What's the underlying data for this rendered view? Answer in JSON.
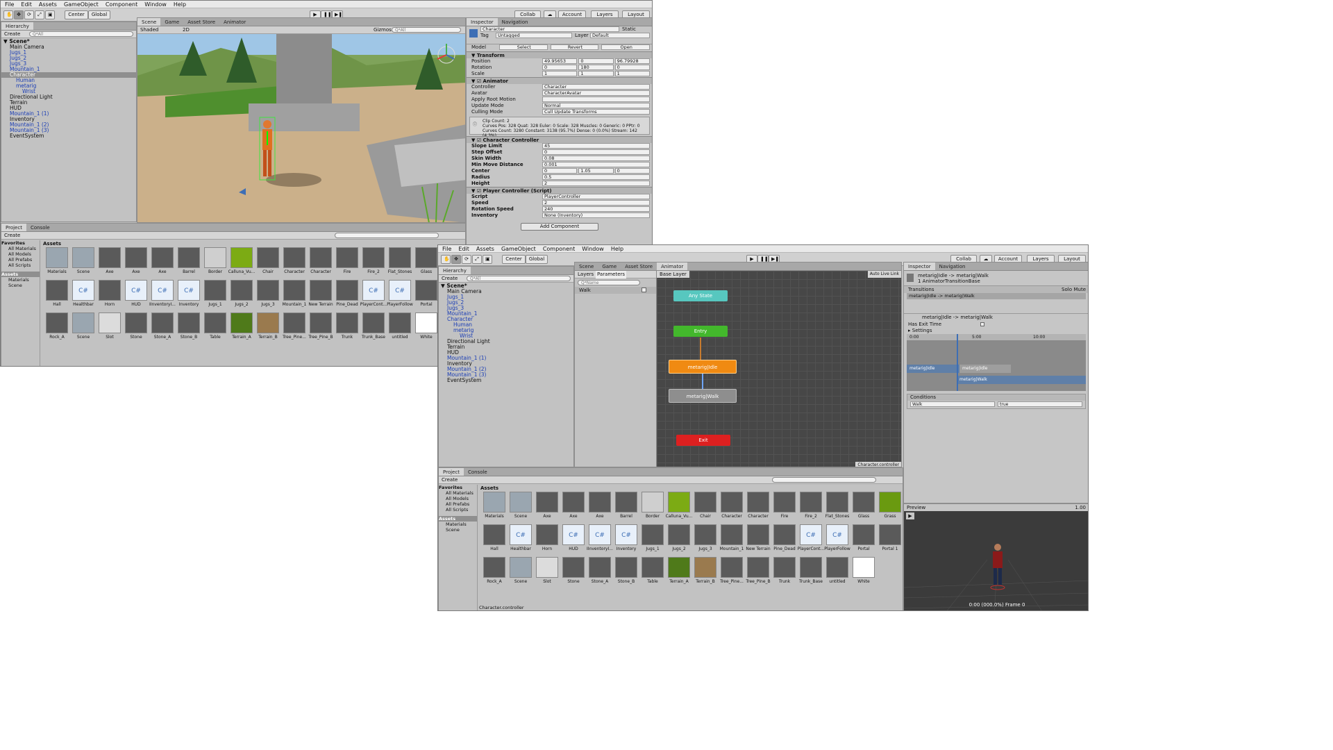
{
  "menu": [
    "File",
    "Edit",
    "Assets",
    "GameObject",
    "Component",
    "Window",
    "Help"
  ],
  "toolbar": {
    "center": "Center",
    "global": "Global",
    "collab": "Collab",
    "account": "Account",
    "layers": "Layers",
    "layout": "Layout"
  },
  "colors": {
    "panel": "#c2c2c2",
    "selection_blue": "#3d6eb5",
    "anystate": "#57c7bf",
    "entry": "#43b82c",
    "idle": "#f08a12",
    "exit": "#dd2020",
    "walk": "#8e8e8e"
  },
  "win1": {
    "hierarchy": {
      "title": "Hierarchy",
      "create": "Create",
      "search": "Q*All",
      "scene": "Scene*",
      "items": [
        {
          "label": "Main Camera",
          "style": "",
          "indent": 1
        },
        {
          "label": "Jugs_1",
          "style": "blue",
          "indent": 1
        },
        {
          "label": "Jugs_2",
          "style": "blue",
          "indent": 1
        },
        {
          "label": "Jugs_3",
          "style": "blue",
          "indent": 1
        },
        {
          "label": "Mountain_1",
          "style": "blue",
          "indent": 1
        },
        {
          "label": "Character",
          "style": "sel",
          "indent": 1
        },
        {
          "label": "Human",
          "style": "blue",
          "indent": 2
        },
        {
          "label": "metarig",
          "style": "blue",
          "indent": 2
        },
        {
          "label": "Wrist",
          "style": "blue",
          "indent": 3
        },
        {
          "label": "Directional Light",
          "style": "",
          "indent": 1
        },
        {
          "label": "Terrain",
          "style": "",
          "indent": 1
        },
        {
          "label": "HUD",
          "style": "",
          "indent": 1
        },
        {
          "label": "Mountain_1 (1)",
          "style": "blue",
          "indent": 1
        },
        {
          "label": "Inventory",
          "style": "",
          "indent": 1
        },
        {
          "label": "Mountain_1 (2)",
          "style": "blue",
          "indent": 1
        },
        {
          "label": "Mountain_1 (3)",
          "style": "blue",
          "indent": 1
        },
        {
          "label": "EventSystem",
          "style": "",
          "indent": 1
        }
      ]
    },
    "scene_tabs": [
      "Scene",
      "Game",
      "Asset Store",
      "Animator"
    ],
    "scene_bar": {
      "shaded": "Shaded",
      "mode2d": "2D",
      "gizmos": "Gizmos",
      "search": "Q*All"
    },
    "inspector": {
      "tabs": [
        "Inspector",
        "Navigation"
      ],
      "object_name": "Character",
      "static": "Static",
      "tag_label": "Tag",
      "tag": "Untagged",
      "layer_label": "Layer",
      "layer": "Default",
      "model_label": "Model",
      "select": "Select",
      "revert": "Revert",
      "open": "Open",
      "transform": {
        "title": "Transform",
        "position_label": "Position",
        "rotation_label": "Rotation",
        "scale_label": "Scale",
        "position": [
          "49.95653",
          "0",
          "96.79928"
        ],
        "rotation": [
          "0",
          "180",
          "0"
        ],
        "scale": [
          "1",
          "1",
          "1"
        ]
      },
      "animator": {
        "title": "Animator",
        "rows": [
          {
            "label": "Controller",
            "value": "Character"
          },
          {
            "label": "Avatar",
            "value": "CharacterAvatar"
          },
          {
            "label": "Apply Root Motion",
            "value": ""
          },
          {
            "label": "Update Mode",
            "value": "Normal"
          },
          {
            "label": "Culling Mode",
            "value": "Cull Update Transforms"
          }
        ],
        "info1": "Clip Count: 2",
        "info2": "Curves Pos: 328 Quat: 328 Euler: 0 Scale: 328 Muscles: 0 Generic: 0 PPtr: 0",
        "info3": "Curves Count: 3280 Constant: 3138 (95.7%) Dense: 0 (0.0%) Stream: 142 (4.3%)"
      },
      "cc": {
        "title": "Character Controller",
        "rows": [
          {
            "label": "Slope Limit",
            "value": "45"
          },
          {
            "label": "Step Offset",
            "value": "0"
          },
          {
            "label": "Skin Width",
            "value": "0.08"
          },
          {
            "label": "Min Move Distance",
            "value": "0.001"
          }
        ],
        "center_label": "Center",
        "center": [
          "0",
          "1.05",
          "0"
        ],
        "rows2": [
          {
            "label": "Radius",
            "value": "0.5"
          },
          {
            "label": "Height",
            "value": "2"
          }
        ]
      },
      "pc": {
        "title": "Player Controller (Script)",
        "rows": [
          {
            "label": "Script",
            "value": "PlayerController"
          },
          {
            "label": "Speed",
            "value": "2"
          },
          {
            "label": "Rotation Speed",
            "value": "240"
          },
          {
            "label": "Inventory",
            "value": "None (Inventory)"
          }
        ]
      },
      "add_component": "Add Component"
    },
    "project": {
      "tabs": [
        "Project",
        "Console"
      ],
      "create": "Create",
      "favorites": "Favorites",
      "fav_items": [
        "All Materials",
        "All Models",
        "All Prefabs",
        "All Scripts"
      ],
      "assets_label": "Assets",
      "folders": [
        "Materials",
        "Scene"
      ],
      "breadcrumb": "Assets",
      "items": [
        "Materials",
        "Scene",
        "Axe",
        "Axe",
        "Axe",
        "Barrel",
        "Border",
        "Calluna_Vu...",
        "Chair",
        "Character",
        "Character",
        "Fire",
        "Fire_2",
        "Flat_Stones",
        "Glass",
        "Hall",
        "Healthbar",
        "Horn",
        "HUD",
        "IInventoryI...",
        "Inventory",
        "Jugs_1",
        "Jugs_2",
        "Jugs_3",
        "Mountain_1",
        "New Terrain",
        "Pine_Dead",
        "PlayerCont...",
        "PlayerFollow",
        "Portal",
        "Rock_A",
        "Scene",
        "Slot",
        "Stone",
        "Stone_A",
        "Stone_B",
        "Table",
        "Terrain_A",
        "Terrain_B",
        "Tree_Pine...",
        "Tree_Pine_B",
        "Trunk",
        "Trunk_Base",
        "untitled",
        "White"
      ]
    }
  },
  "win2": {
    "hierarchy": {
      "title": "Hierarchy",
      "create": "Create",
      "search": "Q*All",
      "scene": "Scene*",
      "items": [
        {
          "label": "Main Camera",
          "style": "",
          "indent": 1
        },
        {
          "label": "Jugs_1",
          "style": "blue",
          "indent": 1
        },
        {
          "label": "Jugs_2",
          "style": "blue",
          "indent": 1
        },
        {
          "label": "Jugs_3",
          "style": "blue",
          "indent": 1
        },
        {
          "label": "Mountain_1",
          "style": "blue",
          "indent": 1
        },
        {
          "label": "Character",
          "style": "blue",
          "indent": 1
        },
        {
          "label": "Human",
          "style": "blue",
          "indent": 2
        },
        {
          "label": "metarig",
          "style": "blue",
          "indent": 2
        },
        {
          "label": "Wrist",
          "style": "blue",
          "indent": 3
        },
        {
          "label": "Directional Light",
          "style": "",
          "indent": 1
        },
        {
          "label": "Terrain",
          "style": "",
          "indent": 1
        },
        {
          "label": "HUD",
          "style": "",
          "indent": 1
        },
        {
          "label": "Mountain_1 (1)",
          "style": "blue",
          "indent": 1
        },
        {
          "label": "Inventory",
          "style": "",
          "indent": 1
        },
        {
          "label": "Mountain_1 (2)",
          "style": "blue",
          "indent": 1
        },
        {
          "label": "Mountain_1 (3)",
          "style": "blue",
          "indent": 1
        },
        {
          "label": "EventSystem",
          "style": "",
          "indent": 1
        }
      ]
    },
    "tabs": [
      "Scene",
      "Game",
      "Asset Store",
      "Animator"
    ],
    "animator": {
      "layers": "Layers",
      "parameters": "Parameters",
      "name_search": "Q*Name",
      "param": "Walk",
      "base_layer": "Base Layer",
      "auto_live": "Auto Live Link",
      "states": {
        "any": "Any State",
        "entry": "Entry",
        "idle": "metarig|Idle",
        "walk": "metarig|Walk",
        "exit": "Exit"
      },
      "footer": "Character.controller"
    },
    "inspector": {
      "tabs": [
        "Inspector",
        "Navigation"
      ],
      "title": "metarig|Idle -> metarig|Walk",
      "subtitle": "1 AnimatorTransitionBase",
      "transitions": "Transitions",
      "solo": "Solo",
      "mute": "Mute",
      "transition_item": "metarig|Idle -> metarig|Walk",
      "transition_name": "metarig|Idle -> metarig|Walk",
      "has_exit": "Has Exit Time",
      "settings": "Settings",
      "timeline": [
        "0:00",
        "5:00",
        "10:00"
      ],
      "clip_a": "metarig|Idle",
      "clip_b": "metarig|Idle",
      "clip_c": "metarig|Walk",
      "conditions": "Conditions",
      "cond_param": "Walk",
      "cond_value": "true"
    },
    "project": {
      "tabs": [
        "Project",
        "Console"
      ],
      "create": "Create",
      "favorites": "Favorites",
      "fav_items": [
        "All Materials",
        "All Models",
        "All Prefabs",
        "All Scripts"
      ],
      "assets_label": "Assets",
      "folders": [
        "Materials",
        "Scene"
      ],
      "breadcrumb": "Assets",
      "items": [
        "Materials",
        "Scene",
        "Axe",
        "Axe",
        "Axe",
        "Barrel",
        "Border",
        "Calluna_Vu...",
        "Chair",
        "Character",
        "Character",
        "Fire",
        "Fire_2",
        "Flat_Stones",
        "Glass",
        "Grass",
        "Hall",
        "Healthbar",
        "Horn",
        "HUD",
        "IInventoryI...",
        "Inventory",
        "Jugs_1",
        "Jugs_2",
        "Jugs_3",
        "Mountain_1",
        "New Terrain",
        "Pine_Dead",
        "PlayerCont...",
        "PlayerFollow",
        "Portal",
        "Portal 1",
        "Rock_A",
        "Scene",
        "Slot",
        "Stone",
        "Stone_A",
        "Stone_B",
        "Table",
        "Terrain_A",
        "Terrain_B",
        "Tree_Pine...",
        "Tree_Pine_B",
        "Trunk",
        "Trunk_Base",
        "untitled",
        "White"
      ],
      "footer": "Character.controller"
    },
    "preview": {
      "title": "Preview",
      "speed": "1.00",
      "status": "0:00 (000.0%) Frame 0"
    }
  }
}
